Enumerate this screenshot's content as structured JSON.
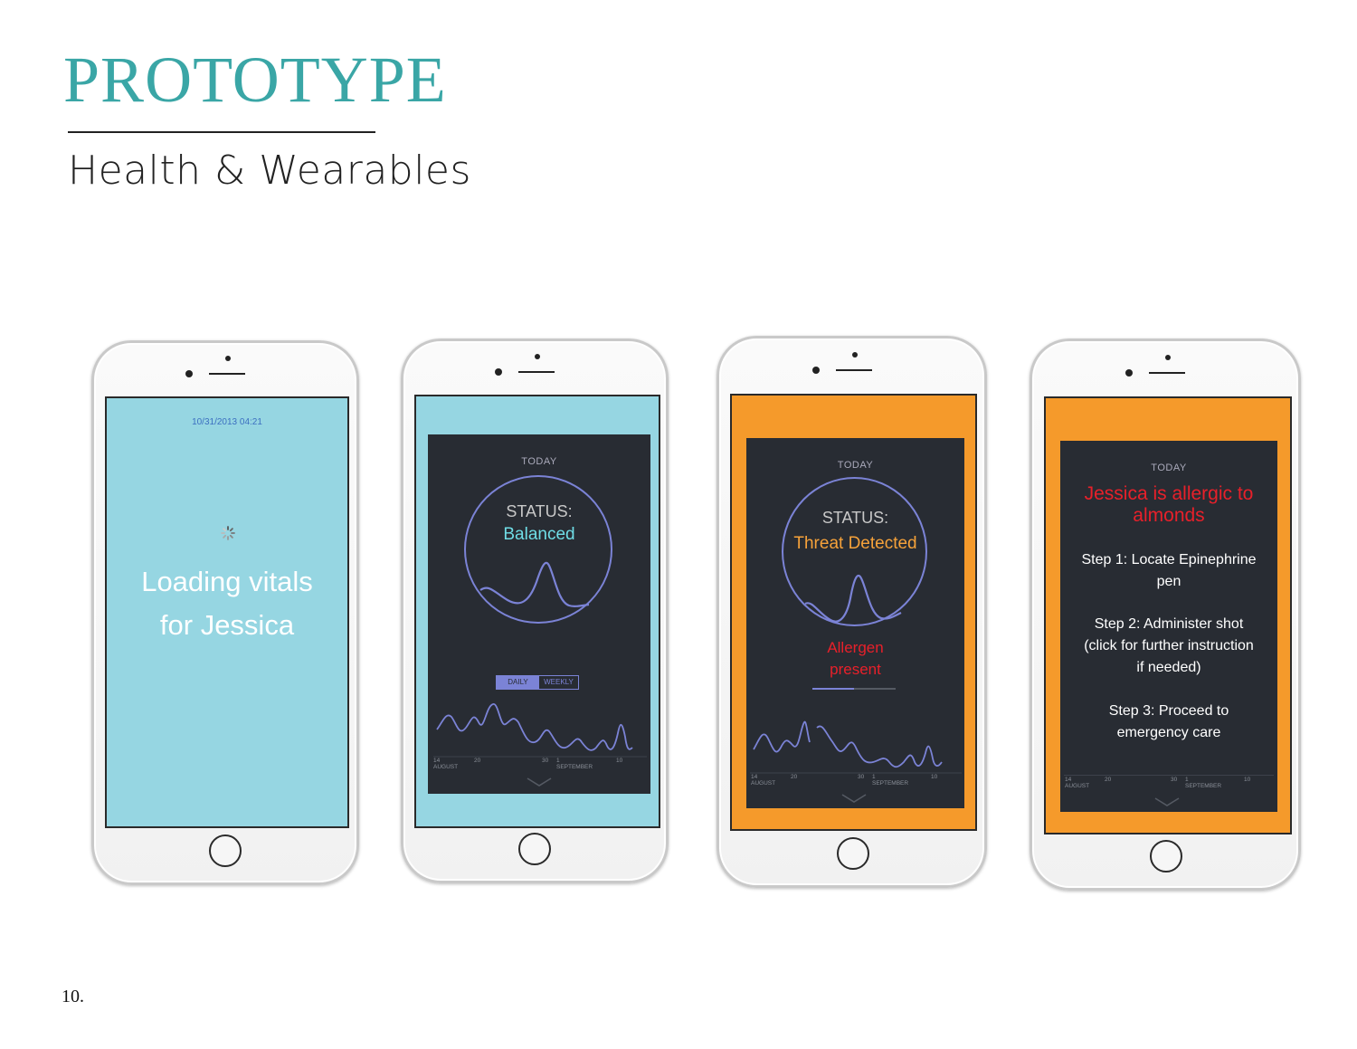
{
  "header": {
    "title": "PROTOTYPE",
    "subtitle": "Health  & Wearables"
  },
  "page_number": "10.",
  "colors": {
    "title": "#3aa6a6",
    "screen_blue": "#96d6e2",
    "screen_orange": "#f59a2b",
    "dark_panel": "#282c33",
    "ring": "#7b83d6",
    "balanced": "#6fdde6",
    "threat": "#f6a23a",
    "alert_red": "#e8202a"
  },
  "screens": {
    "loading": {
      "timestamp": "10/31/2013 04:21",
      "spinner_icon": "loading-spinner-icon",
      "message_line1": "Loading vitals",
      "message_line2": "for Jessica"
    },
    "balanced": {
      "today": "TODAY",
      "status_label": "STATUS:",
      "status_value": "Balanced",
      "toggle": {
        "daily": "DAILY",
        "weekly": "WEEKLY",
        "selected": "DAILY"
      },
      "axis": {
        "x1": "14",
        "x1_month": "AUGUST",
        "x2": "20",
        "x3": "30",
        "x4": "1",
        "x4_month": "SEPTEMBER",
        "x5": "10"
      }
    },
    "threat": {
      "today": "TODAY",
      "status_label": "STATUS:",
      "status_value": "Threat Detected",
      "alert_line1": "Allergen",
      "alert_line2": "present",
      "axis": {
        "x1": "14",
        "x1_month": "AUGUST",
        "x2": "20",
        "x3": "30",
        "x4": "1",
        "x4_month": "SEPTEMBER",
        "x5": "10"
      }
    },
    "instructions": {
      "today": "TODAY",
      "headline_line1": "Jessica is allergic to",
      "headline_line2": "almonds",
      "step1_line1": "Step 1: Locate Epinephrine",
      "step1_line2": "pen",
      "step2_line1": "Step 2: Administer shot",
      "step2_line2": "(click for further instruction",
      "step2_line3": "if needed)",
      "step3_line1": "Step 3: Proceed to",
      "step3_line2": "emergency care",
      "axis": {
        "x1": "14",
        "x1_month": "AUGUST",
        "x2": "20",
        "x3": "30",
        "x4": "1",
        "x4_month": "SEPTEMBER",
        "x5": "10"
      }
    }
  }
}
